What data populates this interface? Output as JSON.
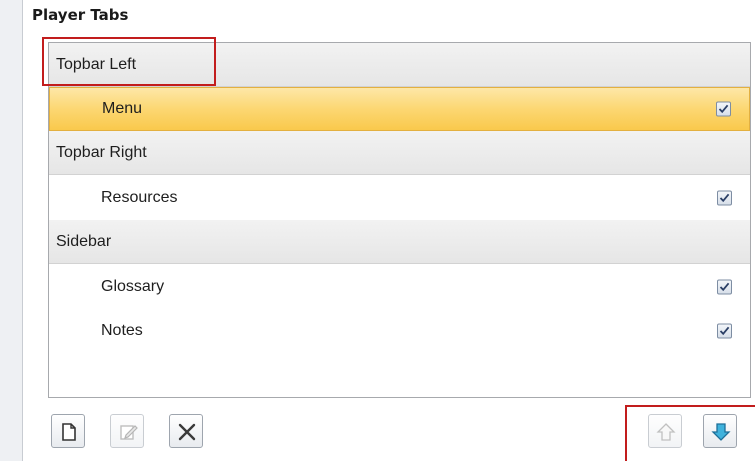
{
  "header": {
    "title": "Player Tabs"
  },
  "rows": [
    {
      "label": "Topbar Left",
      "type": "group"
    },
    {
      "label": "Menu",
      "type": "item",
      "checked": true,
      "selected": true
    },
    {
      "label": "Topbar Right",
      "type": "group"
    },
    {
      "label": "Resources",
      "type": "item",
      "checked": true
    },
    {
      "label": "Sidebar",
      "type": "group"
    },
    {
      "label": "Glossary",
      "type": "item",
      "checked": true
    },
    {
      "label": "Notes",
      "type": "item",
      "checked": true
    }
  ],
  "toolbar": {
    "left_buttons": [
      {
        "icon": "new-page-icon",
        "enabled": true
      },
      {
        "icon": "edit-icon",
        "enabled": false
      },
      {
        "icon": "delete-x-icon",
        "enabled": true
      }
    ],
    "right_buttons": [
      {
        "icon": "move-up-icon",
        "enabled": false
      },
      {
        "icon": "move-down-icon",
        "enabled": true
      }
    ]
  },
  "colors": {
    "highlight_border": "#c21d1d",
    "selection": "#fcd772",
    "group_header": "#ececec"
  }
}
